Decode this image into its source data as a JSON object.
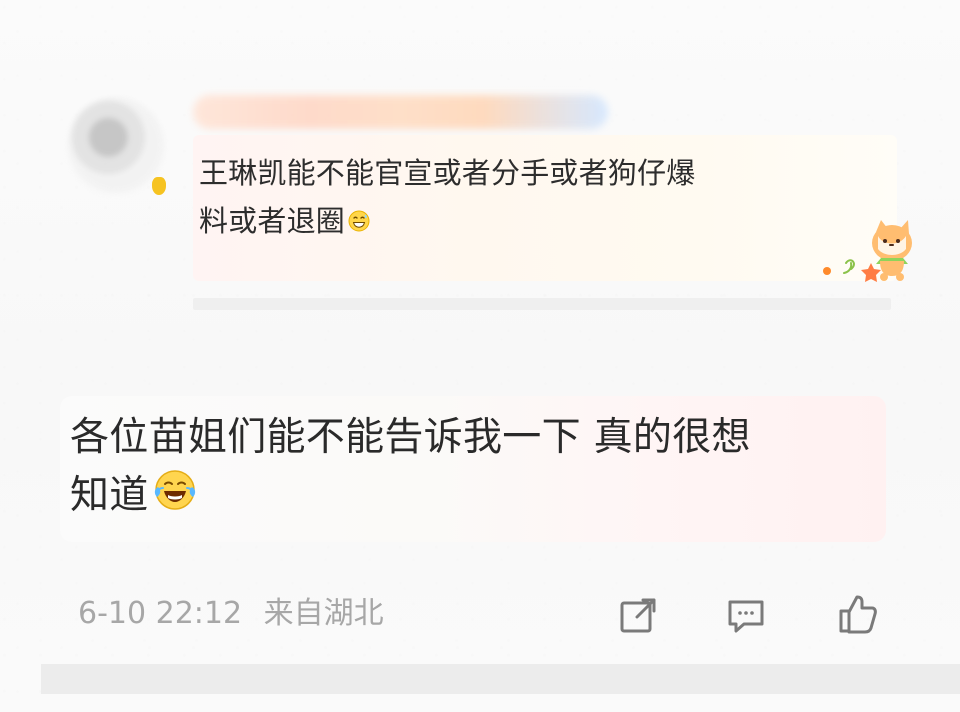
{
  "quoted_comment": {
    "text_line1": "王琳凯能不能官宣或者分手或者狗仔爆",
    "text_line2": "料或者退圈",
    "inline_emoji": "grin-sweat-emoji"
  },
  "main_comment": {
    "text_line1": "各位苗姐们能不能告诉我一下 真的很想",
    "text_line2": "知道",
    "inline_emoji": "laugh-cry-emoji"
  },
  "meta": {
    "date": "6-10 22:12",
    "location": "来自湖北"
  },
  "actions": {
    "share_icon": "share-icon",
    "comment_icon": "comment-icon",
    "like_icon": "like-icon"
  },
  "colors": {
    "text_primary": "#2d2d2d",
    "meta_text": "#a7a7a7",
    "quote_bg": "#fff8ef",
    "main_bg": "#fff5f5",
    "username_blur": "#ffd6c4"
  }
}
